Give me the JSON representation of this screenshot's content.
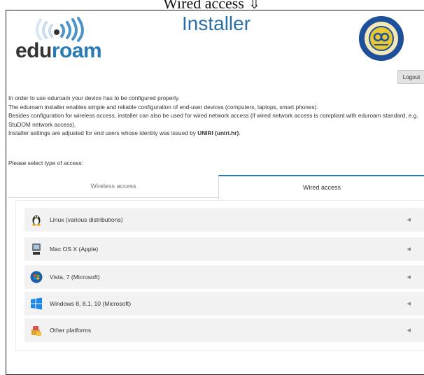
{
  "caption": "Wired access ⇩",
  "header": {
    "logo_edu": "edu",
    "logo_roam": "roam",
    "title": "Installer",
    "logout_label": "Logout"
  },
  "intro": {
    "line1": "In order to use eduroam your device has to be configured properly.",
    "line2": "The eduroam installer enables simple and reliable configuration of end-user devices (computers, laptops, smart phones).",
    "line3": "Besides configuration for wireless access, installer can also be used for wired network access (if wired network access is compliant with eduroam standard, e.g. StuDOM network access).",
    "line4_prefix": "Installer settings are adjusted for end users whose identity was issued by ",
    "line4_org": "UNIRI (uniri.hr)",
    "line4_suffix": "."
  },
  "prompt": "Please select type of access:",
  "tabs": [
    {
      "label": "Wireless access",
      "active": false
    },
    {
      "label": "Wired access",
      "active": true
    }
  ],
  "platforms": [
    {
      "label": "Linux (various distributions)",
      "icon": "linux-penguin-icon"
    },
    {
      "label": "Mac OS X (Apple)",
      "icon": "apple-mac-icon"
    },
    {
      "label": "Vista, 7 (Microsoft)",
      "icon": "windows-vista-orb-icon"
    },
    {
      "label": "Windows 8, 8.1, 10 (Microsoft)",
      "icon": "windows-logo-icon"
    },
    {
      "label": "Other platforms",
      "icon": "other-platforms-icon"
    }
  ],
  "colors": {
    "accent": "#2a7ab6",
    "row_background": "#f2f2f2"
  }
}
